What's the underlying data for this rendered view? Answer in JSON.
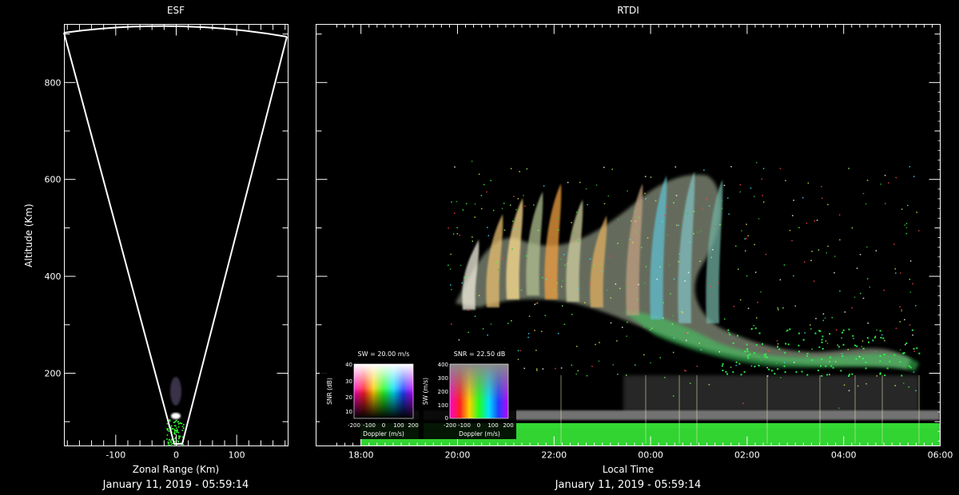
{
  "chart_data": [
    {
      "type": "scatter",
      "title": "ESF",
      "xlabel": "Zonal Range (Km)",
      "ylabel": "Altitude (Km)",
      "xlim": [
        -185,
        185
      ],
      "ylim": [
        50,
        920
      ],
      "x_ticks": [
        "-100",
        "0",
        "100"
      ],
      "x_tick_values": [
        -100,
        0,
        100
      ],
      "y_ticks": [
        "200",
        "400",
        "600",
        "800"
      ],
      "y_tick_values": [
        200,
        400,
        600,
        800
      ],
      "timestamp": "January 11, 2019 - 05:59:14",
      "echo_altitude_range": [
        50,
        140
      ]
    },
    {
      "type": "heatmap",
      "title": "RTDI",
      "xlabel": "Local Time",
      "ylabel": "",
      "x_ticks": [
        "18:00",
        "20:00",
        "22:00",
        "00:00",
        "02:00",
        "04:00",
        "06:00"
      ],
      "x_tick_hours": [
        18,
        20,
        22,
        24,
        26,
        28,
        30
      ],
      "ylim": [
        50,
        920
      ],
      "y_tick_values": [
        200,
        400,
        600,
        800
      ],
      "timestamp": "January 11, 2019 - 05:59:14"
    }
  ],
  "legends": {
    "sw": {
      "title": "SW = 20.00 m/s",
      "ylabel": "SNR (dB)",
      "xlabel": "Doppler (m/s)",
      "y_ticks": [
        "40",
        "30",
        "20",
        "10"
      ],
      "x_ticks": [
        "-200",
        "-100",
        "0",
        "100",
        "200"
      ]
    },
    "snr": {
      "title": "SNR = 22.50 dB",
      "ylabel": "SW (m/s)",
      "xlabel": "Doppler (m/s)",
      "y_ticks": [
        "400",
        "300",
        "200",
        "100",
        "0"
      ],
      "x_ticks": [
        "-200",
        "-100",
        "0",
        "100",
        "200"
      ]
    }
  },
  "colors": {
    "background": "#000000",
    "axes": "#ffffff",
    "noise_band": "#3cff3c"
  }
}
